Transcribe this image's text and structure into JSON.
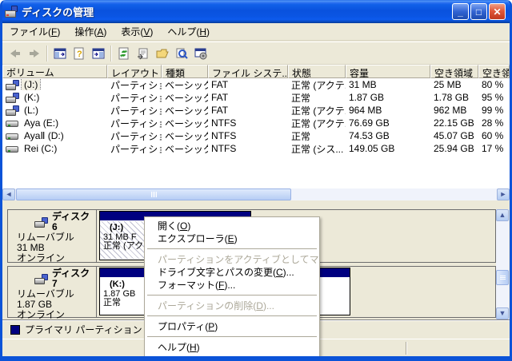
{
  "window": {
    "title": "ディスクの管理"
  },
  "colors": {
    "titlebar_blue": "#0a55e3",
    "window_border": "#0b53d8",
    "face_beige": "#ece9d8",
    "primary_partition_navy": "#000080",
    "disabled_gray": "#aca899",
    "close_red": "#e0583a"
  },
  "titlebar": {
    "buttons": [
      "minimize-icon",
      "maximize-icon",
      "close-icon"
    ],
    "minimize_glyph": "_",
    "maximize_glyph": "□",
    "close_glyph": "✕"
  },
  "menubar": {
    "items": [
      {
        "label": "ファイル(F)"
      },
      {
        "label": "操作(A)"
      },
      {
        "label": "表示(V)"
      },
      {
        "label": "ヘルプ(H)"
      }
    ]
  },
  "toolbar": {
    "icons": [
      "back-icon",
      "forward-icon",
      "console-tree-icon",
      "help-window-icon",
      "action-pane-icon",
      "refresh-icon",
      "export-list-icon",
      "open-folder-icon",
      "search-icon",
      "settings-icon"
    ]
  },
  "volume_list": {
    "columns": [
      "ボリューム",
      "レイアウト",
      "種類",
      "ファイル システ...",
      "状態",
      "容量",
      "空き領域",
      "空き領"
    ],
    "rows": [
      {
        "icon": "removable",
        "name": "(J:)",
        "layout": "パーティション",
        "type": "ベーシック",
        "fs": "FAT",
        "status": "正常 (アクテ...",
        "capacity": "31 MB",
        "free": "25 MB",
        "pct": "80 %"
      },
      {
        "icon": "removable",
        "name": "(K:)",
        "layout": "パーティション",
        "type": "ベーシック",
        "fs": "FAT",
        "status": "正常",
        "capacity": "1.87 GB",
        "free": "1.78 GB",
        "pct": "95 %"
      },
      {
        "icon": "removable",
        "name": "(L:)",
        "layout": "パーティション",
        "type": "ベーシック",
        "fs": "FAT",
        "status": "正常 (アクテ...",
        "capacity": "964 MB",
        "free": "962 MB",
        "pct": "99 %"
      },
      {
        "icon": "hdd",
        "name": "Aya (E:)",
        "layout": "パーティション",
        "type": "ベーシック",
        "fs": "NTFS",
        "status": "正常 (アクテ...",
        "capacity": "76.69 GB",
        "free": "22.15 GB",
        "pct": "28 %"
      },
      {
        "icon": "hdd",
        "name": "AyaⅡ (D:)",
        "layout": "パーティション",
        "type": "ベーシック",
        "fs": "NTFS",
        "status": "正常",
        "capacity": "74.53 GB",
        "free": "45.07 GB",
        "pct": "60 %"
      },
      {
        "icon": "hdd",
        "name": "Rei (C:)",
        "layout": "パーティション",
        "type": "ベーシック",
        "fs": "NTFS",
        "status": "正常 (シス...",
        "capacity": "149.05 GB",
        "free": "25.94 GB",
        "pct": "17 %"
      }
    ]
  },
  "disks": [
    {
      "name": "ディスク 6",
      "kind": "リムーバブル",
      "size": "31 MB",
      "status": "オンライン",
      "partition": {
        "title": "(J:)",
        "line2": "31 MB F",
        "line3": "正常 (アク"
      }
    },
    {
      "name": "ディスク 7",
      "kind": "リムーバブル",
      "size": "1.87 GB",
      "status": "オンライン",
      "partition": {
        "title": "(K:)",
        "line2": "1.87 GB",
        "line3": "正常"
      }
    }
  ],
  "legend": {
    "label": "プライマリ パーティション"
  },
  "context_menu": {
    "items": [
      {
        "label": "開く(O)",
        "enabled": true
      },
      {
        "label": "エクスプローラ(E)",
        "enabled": true
      },
      {
        "label": "パーティションをアクティブとしてマーク(M)",
        "enabled": false
      },
      {
        "label": "ドライブ文字とパスの変更(C)...",
        "enabled": true
      },
      {
        "label": "フォーマット(F)...",
        "enabled": true
      },
      {
        "label": "パーティションの削除(D)...",
        "enabled": false
      },
      {
        "label": "プロパティ(P)",
        "enabled": true
      },
      {
        "label": "ヘルプ(H)",
        "enabled": true
      }
    ]
  }
}
